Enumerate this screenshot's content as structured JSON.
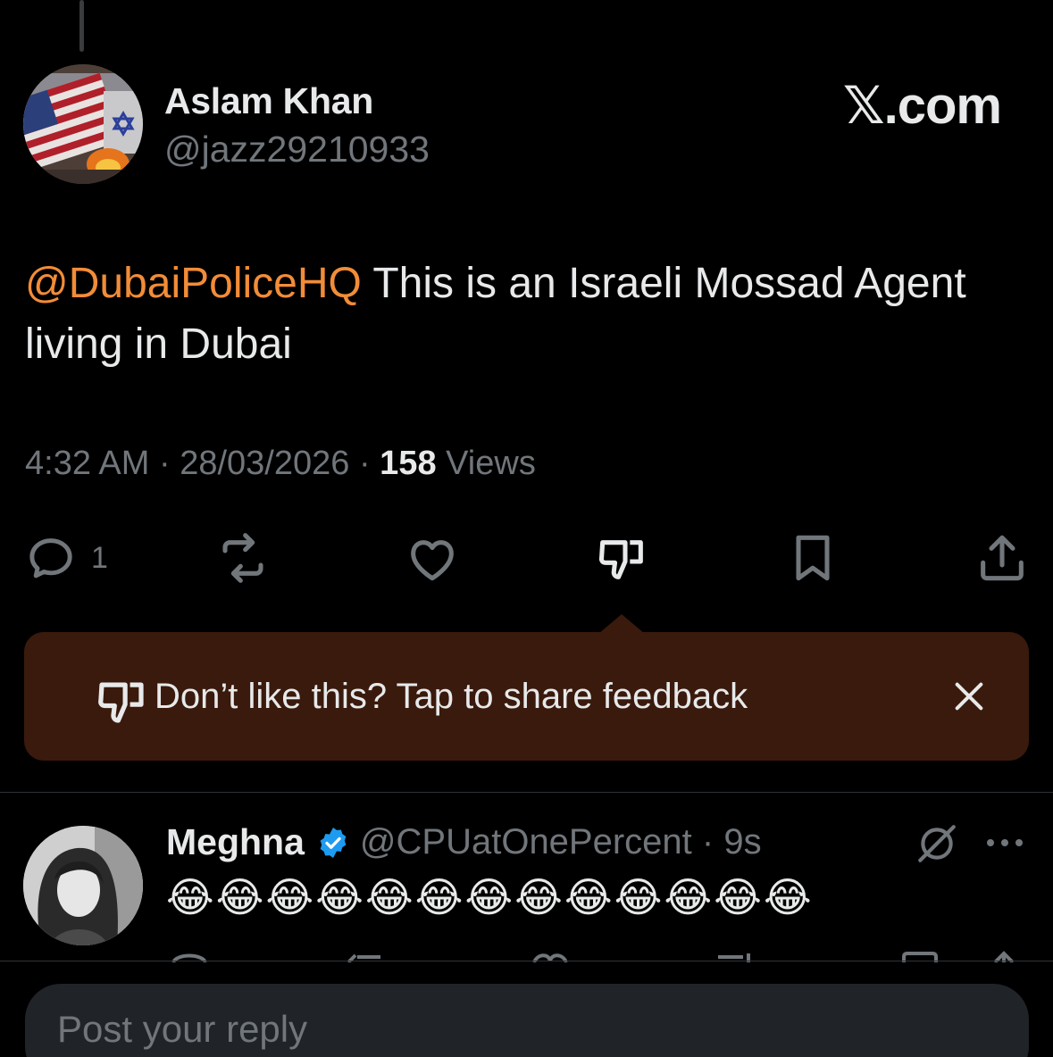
{
  "tweet": {
    "author_name": "Aslam Khan",
    "author_handle": "@jazz29210933",
    "mention": "@DubaiPoliceHQ",
    "text": " This is an Israeli Mossad Agent living in Dubai",
    "time": "4:32 AM",
    "date": "28/03/2026",
    "views_count": "158",
    "views_label": "Views",
    "separator": "·",
    "reply_count": "1"
  },
  "brand": {
    "label": "𝕏.com"
  },
  "feedback_tooltip": {
    "text": "Don’t like this? Tap to share feedback"
  },
  "reply": {
    "name": "Meghna",
    "handle_time": "@CPUatOnePercent · 9s",
    "body": "😂😂😂😂😂😂😂😂😂😂😂😂😂"
  },
  "composer": {
    "placeholder": "Post your reply"
  },
  "colors": {
    "mention": "#f28c38",
    "tooltip_bg": "#3a1a0c",
    "verified": "#1d9bf0",
    "muted": "#71767b"
  },
  "icons": [
    "reply-icon",
    "repost-icon",
    "like-icon",
    "dislike-icon",
    "bookmark-icon",
    "share-icon",
    "close-icon",
    "verified-badge-icon",
    "grok-icon",
    "more-icon"
  ]
}
